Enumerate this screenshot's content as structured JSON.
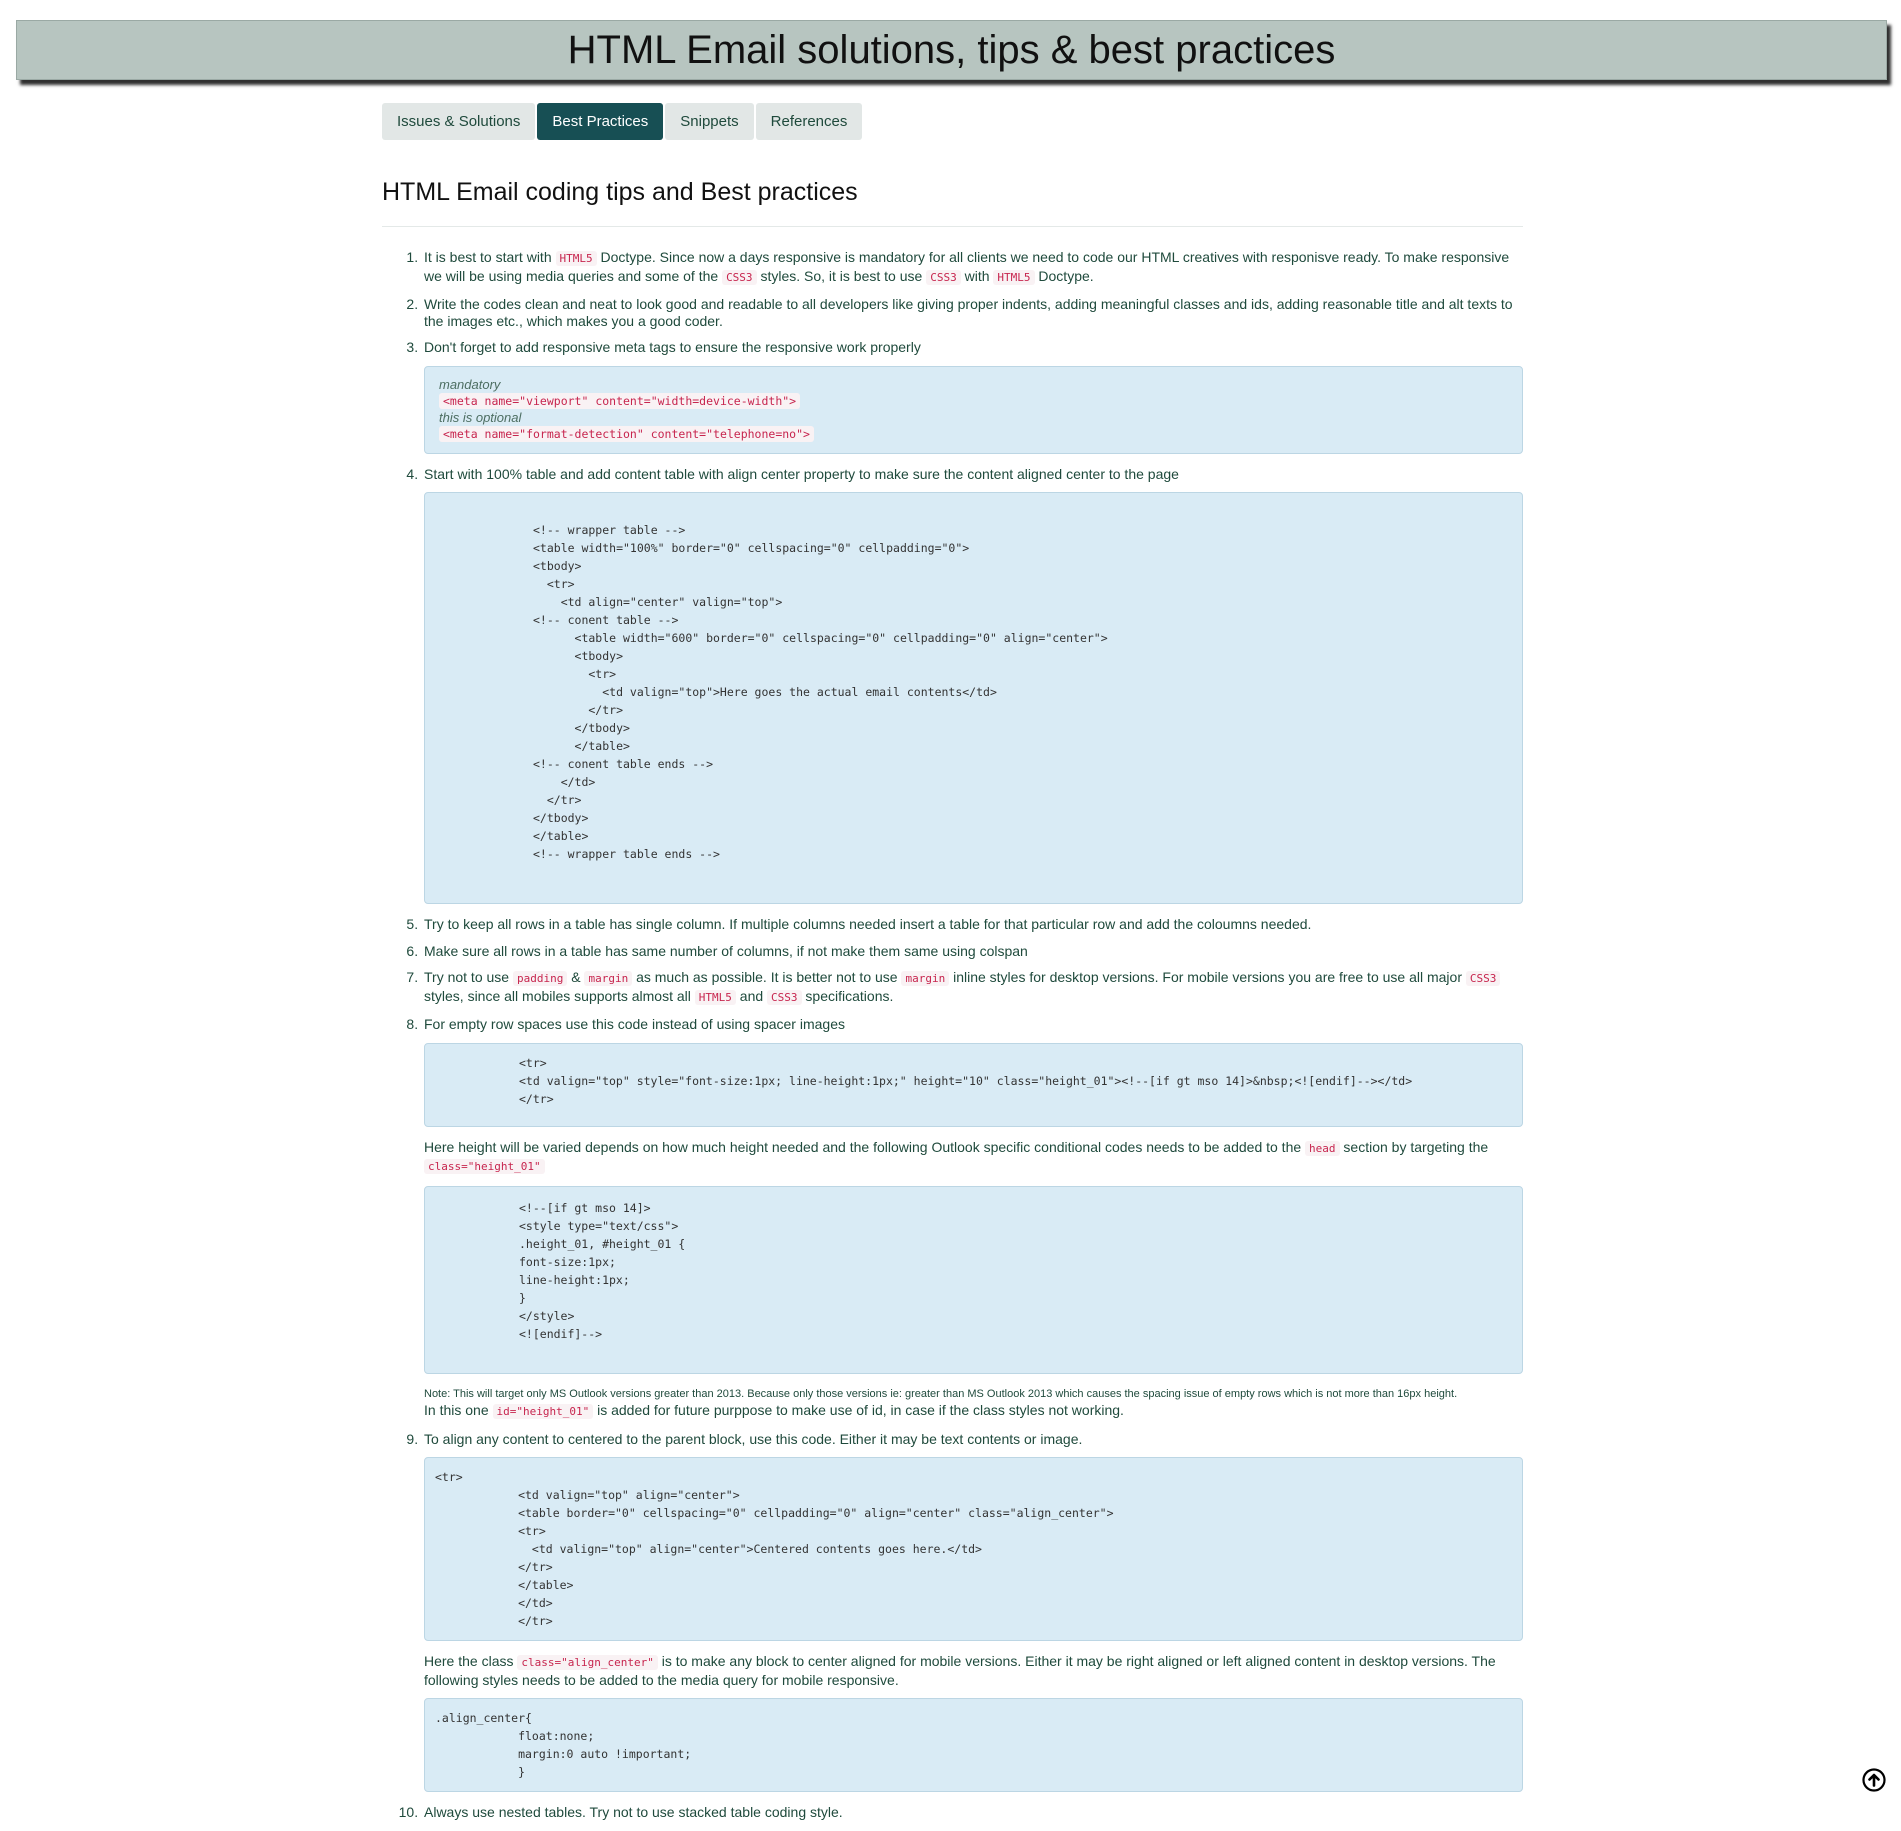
{
  "header": {
    "title": "HTML Email solutions, tips & best practices"
  },
  "tabs": [
    {
      "label": "Issues & Solutions"
    },
    {
      "label": "Best Practices",
      "active": true
    },
    {
      "label": "Snippets"
    },
    {
      "label": "References"
    }
  ],
  "page": {
    "title": "HTML Email coding tips and Best practices"
  },
  "items": {
    "t1a": "It is best to start with ",
    "c_html5": "HTML5",
    "t1b": " Doctype. Since now a days responsive is mandatory for all clients we need to code our HTML creatives with responisve ready. To make responsive we will be using media queries and some of the ",
    "c_css3": "CSS3",
    "t1c": " styles. So, it is best to use ",
    "t1d": " with ",
    "t1e": " Doctype.",
    "t2": "Write the codes clean and neat to look good and readable to all developers like giving proper indents, adding meaningful classes and ids, adding reasonable title and alt texts to the images etc., which makes you a good coder.",
    "t3": "Don't forget to add responsive meta tags to ensure the responsive work properly",
    "meta_label1": "mandatory",
    "meta_code1": "<meta name=\"viewport\" content=\"width=device-width\">",
    "meta_label2": "this is optional",
    "meta_code2": "<meta name=\"format-detection\" content=\"telephone=no\">",
    "t4": "Start with 100% table and add content table with align center property to make sure the content aligned center to the page",
    "code4": "<!-- wrapper table -->\n<table width=\"100%\" border=\"0\" cellspacing=\"0\" cellpadding=\"0\">\n<tbody>\n  <tr>\n    <td align=\"center\" valign=\"top\">\n<!-- conent table -->\n      <table width=\"600\" border=\"0\" cellspacing=\"0\" cellpadding=\"0\" align=\"center\">\n      <tbody>\n        <tr>\n          <td valign=\"top\">Here goes the actual email contents</td>\n        </tr>\n      </tbody>\n      </table>\n<!-- conent table ends -->\n    </td>\n  </tr>\n</tbody>\n</table>\n<!-- wrapper table ends -->",
    "t5": "Try to keep all rows in a table has single column. If multiple columns needed insert a table for that particular row and add the coloumns needed.",
    "t6": "Make sure all rows in a table has same number of columns, if not make them same using colspan",
    "t7a": "Try not to use ",
    "c_padding": "padding",
    "t7b": " & ",
    "c_margin": "margin",
    "t7c": " as much as possible. It is better not to use ",
    "t7d": " inline styles for desktop versions. For mobile versions you are free to use all major ",
    "t7e": " styles, since all mobiles supports almost all ",
    "t7f": " and ",
    "t7g": " specifications.",
    "t8": "For empty row spaces use this code instead of using spacer images",
    "code8": "<tr>\n<td valign=\"top\" style=\"font-size:1px; line-height:1px;\" height=\"10\" class=\"height_01\"><!--[if gt mso 14]>&nbsp;<![endif]--></td>\n</tr>",
    "t8b": "Here height will be varied depends on how much height needed and the following Outlook specific conditional codes needs to be added to the ",
    "c_head": "head",
    "t8c": " section by targeting the ",
    "c_class_height": "class=\"height_01\"",
    "code8b": "<!--[if gt mso 14]>\n<style type=\"text/css\">\n.height_01, #height_01 {\nfont-size:1px;\nline-height:1px;\n}\n</style>\n<![endif]-->",
    "note8": "Note: This will target only MS Outlook versions greater than 2013. Because only those versions ie: greater than MS Outlook 2013 which causes the spacing issue of empty rows which is not more than 16px height.",
    "t8d": "In this one ",
    "c_id_height": "id=\"height_01\"",
    "t8e": " is added for future purppose to make use of id, in case if the class styles not working.",
    "t9": "To align any content to centered to the parent block, use this code. Either it may be text contents or image.",
    "code9": "<tr>\n            <td valign=\"top\" align=\"center\">\n            <table border=\"0\" cellspacing=\"0\" cellpadding=\"0\" align=\"center\" class=\"align_center\">\n            <tr>\n              <td valign=\"top\" align=\"center\">Centered contents goes here.</td>\n            </tr>\n            </table>\n            </td>\n            </tr>",
    "t9b": "Here the class ",
    "c_class_align": "class=\"align_center\"",
    "t9c": " is to make any block to center aligned for mobile versions. Either it may be right aligned or left aligned content in desktop versions. The following styles needs to be added to the media query for mobile responsive.",
    "code9b": ".align_center{\n            float:none;\n            margin:0 auto !important;\n            }",
    "t10": "Always use nested tables. Try not to use stacked table coding style."
  },
  "icons": {
    "scroll_top": "arrow-up-circle-icon"
  },
  "colors": {
    "accent": "#174f54",
    "header_bg": "#b7c5c0",
    "code_bg": "#d9ebf5",
    "code_text": "#c7254e"
  }
}
